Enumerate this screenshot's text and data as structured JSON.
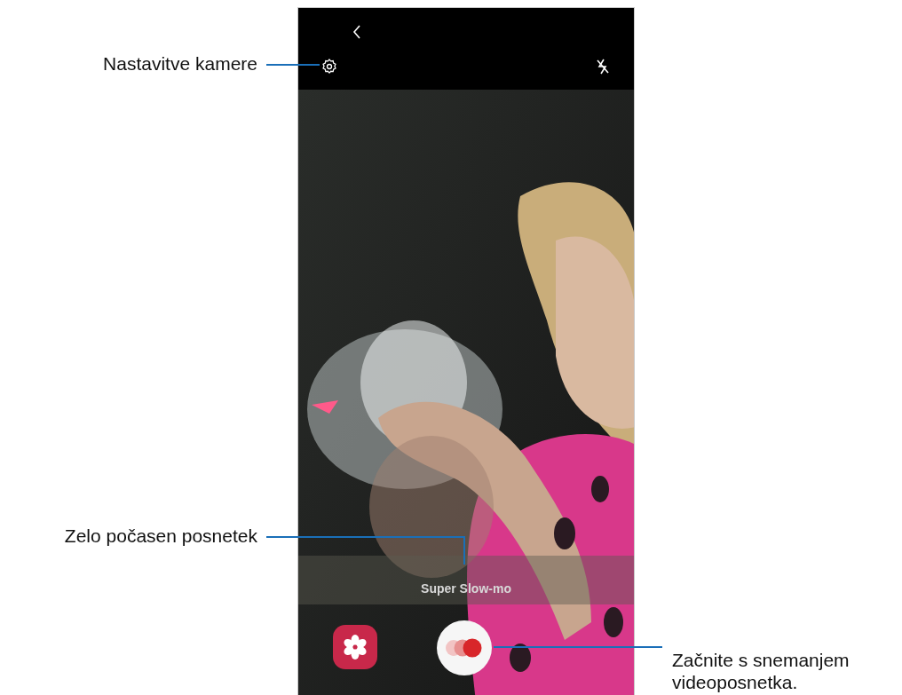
{
  "callouts": [
    {
      "kind": "left",
      "text": "Nastavitve kamere"
    },
    {
      "kind": "elbow",
      "text": "Zelo počasen posnetek"
    },
    {
      "kind": "right",
      "text": "Začnite s snemanjem videoposnetka."
    }
  ],
  "camera": {
    "mode_label": "Super Slow-mo"
  }
}
